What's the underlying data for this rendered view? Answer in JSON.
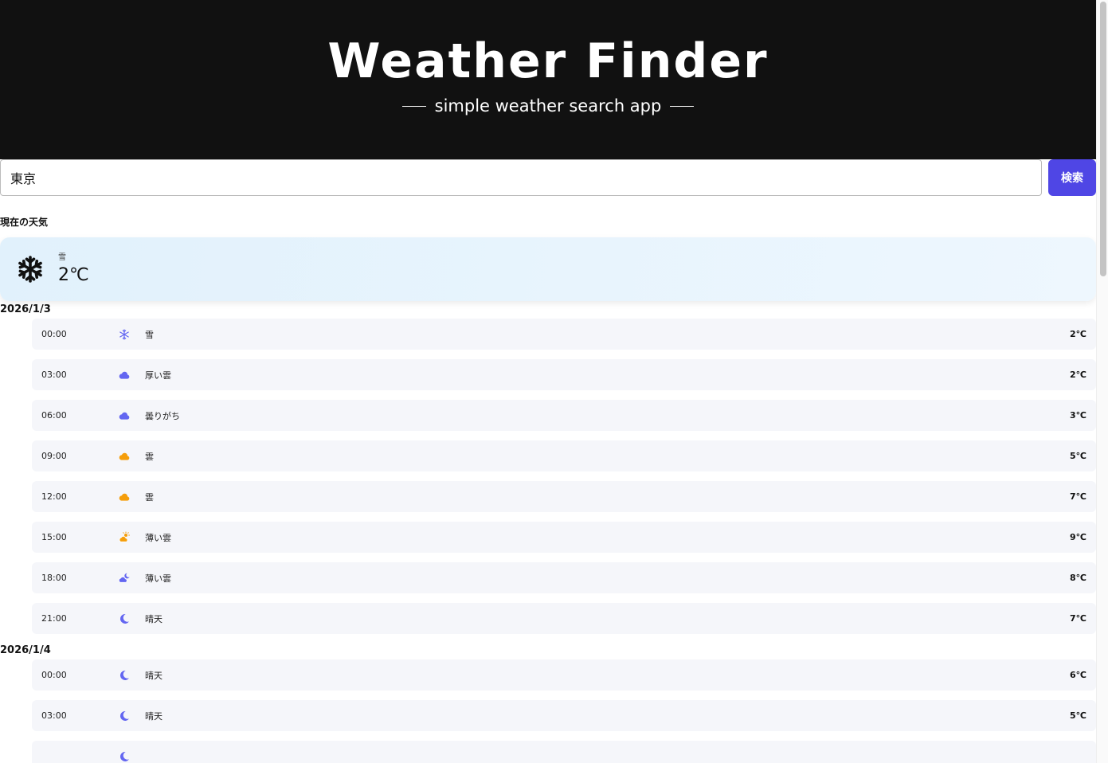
{
  "header": {
    "title": "Weather Finder",
    "subtitle": "simple weather search app"
  },
  "search": {
    "value": "東京",
    "button_label": "検索"
  },
  "current": {
    "section_title": "現在の天気",
    "icon": "snowflake-icon",
    "description": "雪",
    "temperature": "2℃"
  },
  "colors": {
    "accent": "#4f46e5",
    "orange": "#f59e0b",
    "header_bg": "#111111"
  },
  "days": [
    {
      "date": "2026/1/3",
      "items": [
        {
          "time": "00:00",
          "icon": "snowflake-icon",
          "color": "#6366f1",
          "desc": "雪",
          "temp": "2℃"
        },
        {
          "time": "03:00",
          "icon": "cloud-icon",
          "color": "#6366f1",
          "desc": "厚い雲",
          "temp": "2℃"
        },
        {
          "time": "06:00",
          "icon": "cloud-icon",
          "color": "#6366f1",
          "desc": "曇りがち",
          "temp": "3℃"
        },
        {
          "time": "09:00",
          "icon": "cloud-icon",
          "color": "#f59e0b",
          "desc": "雲",
          "temp": "5℃"
        },
        {
          "time": "12:00",
          "icon": "cloud-icon",
          "color": "#f59e0b",
          "desc": "雲",
          "temp": "7℃"
        },
        {
          "time": "15:00",
          "icon": "cloud-sun-icon",
          "color": "#f59e0b",
          "desc": "薄い雲",
          "temp": "9℃"
        },
        {
          "time": "18:00",
          "icon": "cloud-moon-icon",
          "color": "#6366f1",
          "desc": "薄い雲",
          "temp": "8℃"
        },
        {
          "time": "21:00",
          "icon": "moon-icon",
          "color": "#6366f1",
          "desc": "晴天",
          "temp": "7℃"
        }
      ]
    },
    {
      "date": "2026/1/4",
      "items": [
        {
          "time": "00:00",
          "icon": "moon-icon",
          "color": "#6366f1",
          "desc": "晴天",
          "temp": "6℃"
        },
        {
          "time": "03:00",
          "icon": "moon-icon",
          "color": "#6366f1",
          "desc": "晴天",
          "temp": "5℃"
        },
        {
          "time": "",
          "icon": "moon-icon",
          "color": "#6366f1",
          "desc": "",
          "temp": ""
        }
      ]
    }
  ]
}
